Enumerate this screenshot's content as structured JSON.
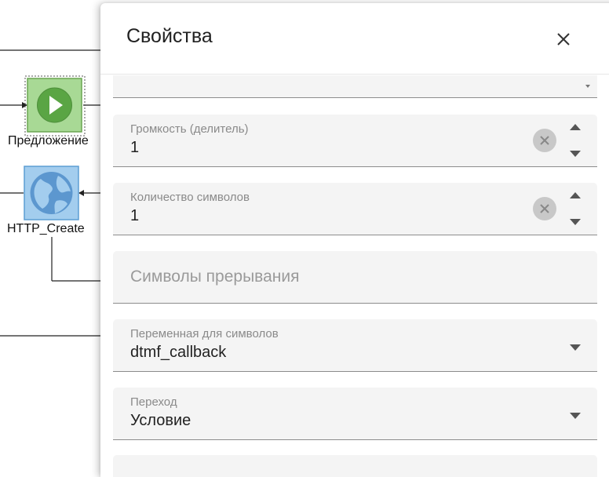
{
  "diagram": {
    "nodes": [
      {
        "label": "Предложение",
        "icon": "play-icon",
        "color": "#a8d995"
      },
      {
        "label": "HTTP_Create",
        "icon": "globe-icon",
        "color": "#a3cdee"
      }
    ]
  },
  "panel": {
    "title": "Свойства",
    "close_icon": "close-icon",
    "fields": [
      {
        "label": "Громкость (делитель)",
        "value": "1",
        "type": "number"
      },
      {
        "label": "Количество символов",
        "value": "1",
        "type": "number"
      },
      {
        "label": "",
        "placeholder": "Символы прерывания",
        "value": "",
        "type": "text"
      },
      {
        "label": "Переменная для символов",
        "value": "dtmf_callback",
        "type": "select"
      },
      {
        "label": "Переход",
        "value": "Условие",
        "type": "select"
      }
    ]
  },
  "colors": {
    "field_bg": "#f4f4f4",
    "clear_button": "#c8c8c8",
    "play_node": "#a8d995",
    "http_node": "#a3cdee"
  }
}
